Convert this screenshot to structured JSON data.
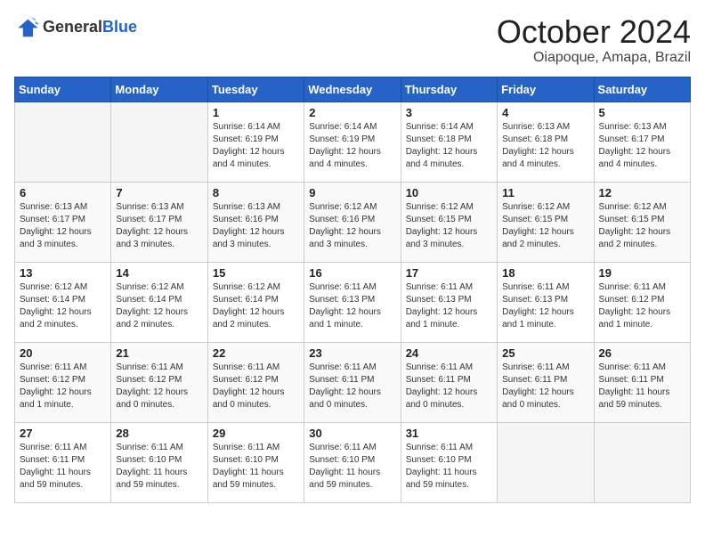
{
  "logo": {
    "general": "General",
    "blue": "Blue"
  },
  "title": "October 2024",
  "location": "Oiapoque, Amapa, Brazil",
  "weekdays": [
    "Sunday",
    "Monday",
    "Tuesday",
    "Wednesday",
    "Thursday",
    "Friday",
    "Saturday"
  ],
  "weeks": [
    [
      {
        "day": "",
        "info": ""
      },
      {
        "day": "",
        "info": ""
      },
      {
        "day": "1",
        "info": "Sunrise: 6:14 AM\nSunset: 6:19 PM\nDaylight: 12 hours and 4 minutes."
      },
      {
        "day": "2",
        "info": "Sunrise: 6:14 AM\nSunset: 6:19 PM\nDaylight: 12 hours and 4 minutes."
      },
      {
        "day": "3",
        "info": "Sunrise: 6:14 AM\nSunset: 6:18 PM\nDaylight: 12 hours and 4 minutes."
      },
      {
        "day": "4",
        "info": "Sunrise: 6:13 AM\nSunset: 6:18 PM\nDaylight: 12 hours and 4 minutes."
      },
      {
        "day": "5",
        "info": "Sunrise: 6:13 AM\nSunset: 6:17 PM\nDaylight: 12 hours and 4 minutes."
      }
    ],
    [
      {
        "day": "6",
        "info": "Sunrise: 6:13 AM\nSunset: 6:17 PM\nDaylight: 12 hours and 3 minutes."
      },
      {
        "day": "7",
        "info": "Sunrise: 6:13 AM\nSunset: 6:17 PM\nDaylight: 12 hours and 3 minutes."
      },
      {
        "day": "8",
        "info": "Sunrise: 6:13 AM\nSunset: 6:16 PM\nDaylight: 12 hours and 3 minutes."
      },
      {
        "day": "9",
        "info": "Sunrise: 6:12 AM\nSunset: 6:16 PM\nDaylight: 12 hours and 3 minutes."
      },
      {
        "day": "10",
        "info": "Sunrise: 6:12 AM\nSunset: 6:15 PM\nDaylight: 12 hours and 3 minutes."
      },
      {
        "day": "11",
        "info": "Sunrise: 6:12 AM\nSunset: 6:15 PM\nDaylight: 12 hours and 2 minutes."
      },
      {
        "day": "12",
        "info": "Sunrise: 6:12 AM\nSunset: 6:15 PM\nDaylight: 12 hours and 2 minutes."
      }
    ],
    [
      {
        "day": "13",
        "info": "Sunrise: 6:12 AM\nSunset: 6:14 PM\nDaylight: 12 hours and 2 minutes."
      },
      {
        "day": "14",
        "info": "Sunrise: 6:12 AM\nSunset: 6:14 PM\nDaylight: 12 hours and 2 minutes."
      },
      {
        "day": "15",
        "info": "Sunrise: 6:12 AM\nSunset: 6:14 PM\nDaylight: 12 hours and 2 minutes."
      },
      {
        "day": "16",
        "info": "Sunrise: 6:11 AM\nSunset: 6:13 PM\nDaylight: 12 hours and 1 minute."
      },
      {
        "day": "17",
        "info": "Sunrise: 6:11 AM\nSunset: 6:13 PM\nDaylight: 12 hours and 1 minute."
      },
      {
        "day": "18",
        "info": "Sunrise: 6:11 AM\nSunset: 6:13 PM\nDaylight: 12 hours and 1 minute."
      },
      {
        "day": "19",
        "info": "Sunrise: 6:11 AM\nSunset: 6:12 PM\nDaylight: 12 hours and 1 minute."
      }
    ],
    [
      {
        "day": "20",
        "info": "Sunrise: 6:11 AM\nSunset: 6:12 PM\nDaylight: 12 hours and 1 minute."
      },
      {
        "day": "21",
        "info": "Sunrise: 6:11 AM\nSunset: 6:12 PM\nDaylight: 12 hours and 0 minutes."
      },
      {
        "day": "22",
        "info": "Sunrise: 6:11 AM\nSunset: 6:12 PM\nDaylight: 12 hours and 0 minutes."
      },
      {
        "day": "23",
        "info": "Sunrise: 6:11 AM\nSunset: 6:11 PM\nDaylight: 12 hours and 0 minutes."
      },
      {
        "day": "24",
        "info": "Sunrise: 6:11 AM\nSunset: 6:11 PM\nDaylight: 12 hours and 0 minutes."
      },
      {
        "day": "25",
        "info": "Sunrise: 6:11 AM\nSunset: 6:11 PM\nDaylight: 12 hours and 0 minutes."
      },
      {
        "day": "26",
        "info": "Sunrise: 6:11 AM\nSunset: 6:11 PM\nDaylight: 11 hours and 59 minutes."
      }
    ],
    [
      {
        "day": "27",
        "info": "Sunrise: 6:11 AM\nSunset: 6:11 PM\nDaylight: 11 hours and 59 minutes."
      },
      {
        "day": "28",
        "info": "Sunrise: 6:11 AM\nSunset: 6:10 PM\nDaylight: 11 hours and 59 minutes."
      },
      {
        "day": "29",
        "info": "Sunrise: 6:11 AM\nSunset: 6:10 PM\nDaylight: 11 hours and 59 minutes."
      },
      {
        "day": "30",
        "info": "Sunrise: 6:11 AM\nSunset: 6:10 PM\nDaylight: 11 hours and 59 minutes."
      },
      {
        "day": "31",
        "info": "Sunrise: 6:11 AM\nSunset: 6:10 PM\nDaylight: 11 hours and 59 minutes."
      },
      {
        "day": "",
        "info": ""
      },
      {
        "day": "",
        "info": ""
      }
    ]
  ]
}
